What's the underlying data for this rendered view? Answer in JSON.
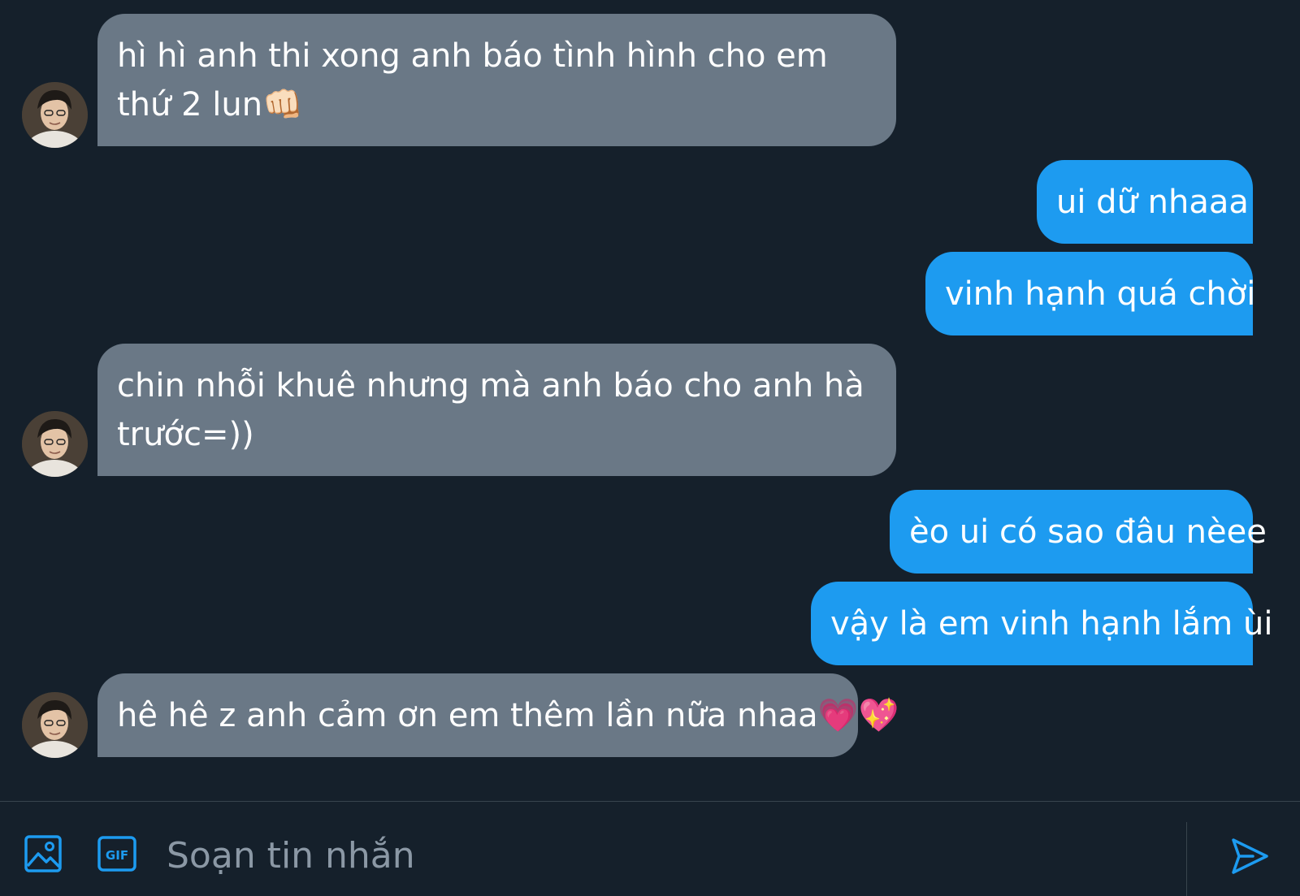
{
  "messages": [
    {
      "direction": "in",
      "text": "hì hì anh thi xong anh báo tình hình cho em thứ 2 lun👊🏻"
    },
    {
      "direction": "out",
      "text": "ui dữ nhaaa"
    },
    {
      "direction": "out",
      "text": "vinh hạnh quá chời"
    },
    {
      "direction": "in",
      "text": "chin nhỗi khuê nhưng mà anh báo cho anh hà trước=))"
    },
    {
      "direction": "out",
      "text": "èo ui có sao đâu nèee"
    },
    {
      "direction": "out",
      "text": "vậy là em vinh hạnh lắm ùi"
    },
    {
      "direction": "in",
      "text": "hê hê z anh cảm ơn em thêm lần nữa nhaa💗💖"
    }
  ],
  "composer": {
    "placeholder": "Soạn tin nhắn",
    "image_icon": "image-icon",
    "gif_icon": "gif-icon",
    "gif_label": "GIF",
    "send_icon": "send-icon"
  },
  "colors": {
    "background": "#15202b",
    "incoming_bubble": "#6a7886",
    "outgoing_bubble": "#1d9bf0",
    "accent": "#1d9bf0",
    "placeholder": "#8b98a5"
  }
}
